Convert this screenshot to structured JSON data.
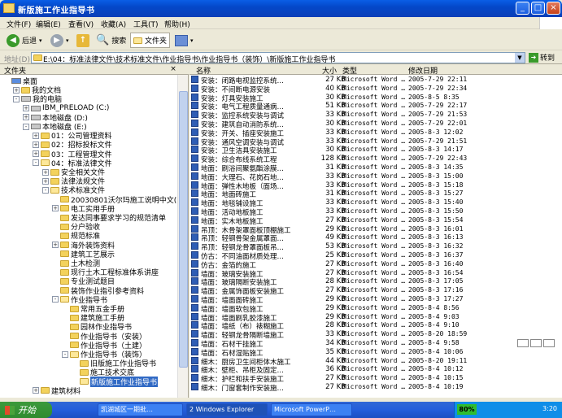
{
  "window": {
    "title": "新版施工作业指导书"
  },
  "menu": [
    "文件(F)",
    "编辑(E)",
    "查看(V)",
    "收藏(A)",
    "工具(T)",
    "帮助(H)"
  ],
  "toolbar": {
    "back": "后退",
    "search": "搜索",
    "folders": "文件夹"
  },
  "address": {
    "label": "地址(D)",
    "path": "E:\\04：标准法律文件\\技术标准文件\\作业指导书\\作业指导书（装饰）\\新版施工作业指导书",
    "go": "转到"
  },
  "left_pane": {
    "title": "文件夹"
  },
  "tree": [
    {
      "label": "桌面",
      "indent": 0,
      "exp": "",
      "icon": "desktop"
    },
    {
      "label": "我的文档",
      "indent": 1,
      "exp": "+",
      "icon": "folder"
    },
    {
      "label": "我的电脑",
      "indent": 1,
      "exp": "-",
      "icon": "computer"
    },
    {
      "label": "IBM_PRELOAD (C:)",
      "indent": 2,
      "exp": "+",
      "icon": "drive"
    },
    {
      "label": "本地磁盘 (D:)",
      "indent": 2,
      "exp": "+",
      "icon": "drive"
    },
    {
      "label": "本地磁盘 (E:)",
      "indent": 2,
      "exp": "-",
      "icon": "drive"
    },
    {
      "label": "01：公司管理资料",
      "indent": 3,
      "exp": "+",
      "icon": "folder"
    },
    {
      "label": "02：招标投标文件",
      "indent": 3,
      "exp": "+",
      "icon": "folder"
    },
    {
      "label": "03：工程管理文件",
      "indent": 3,
      "exp": "+",
      "icon": "folder"
    },
    {
      "label": "04：标准法律文件",
      "indent": 3,
      "exp": "-",
      "icon": "folder-open"
    },
    {
      "label": "安全相关文件",
      "indent": 4,
      "exp": "+",
      "icon": "folder"
    },
    {
      "label": "法律法规文件",
      "indent": 4,
      "exp": "+",
      "icon": "folder"
    },
    {
      "label": "技术标准文件",
      "indent": 4,
      "exp": "-",
      "icon": "folder-open"
    },
    {
      "label": "20030801沃尔玛施工说明中文(2009)",
      "indent": 5,
      "exp": "",
      "icon": "folder"
    },
    {
      "label": "电工实用手册",
      "indent": 5,
      "exp": "+",
      "icon": "folder"
    },
    {
      "label": "发达同事要求学习的规范清单",
      "indent": 5,
      "exp": "",
      "icon": "folder"
    },
    {
      "label": "分户验收",
      "indent": 5,
      "exp": "",
      "icon": "folder"
    },
    {
      "label": "规范标准",
      "indent": 5,
      "exp": "",
      "icon": "folder"
    },
    {
      "label": "海外装饰资料",
      "indent": 5,
      "exp": "+",
      "icon": "folder"
    },
    {
      "label": "建筑工艺展示",
      "indent": 5,
      "exp": "",
      "icon": "folder"
    },
    {
      "label": "土木检测",
      "indent": 5,
      "exp": "",
      "icon": "folder"
    },
    {
      "label": "现行土木工程标准体系讲座",
      "indent": 5,
      "exp": "",
      "icon": "folder"
    },
    {
      "label": "专业测试题目",
      "indent": 5,
      "exp": "",
      "icon": "folder"
    },
    {
      "label": "装饰作业指引参考资料",
      "indent": 5,
      "exp": "",
      "icon": "folder"
    },
    {
      "label": "作业指导书",
      "indent": 5,
      "exp": "-",
      "icon": "folder-open"
    },
    {
      "label": "常用五金手册",
      "indent": 6,
      "exp": "",
      "icon": "folder"
    },
    {
      "label": "建筑施工手册",
      "indent": 6,
      "exp": "",
      "icon": "folder"
    },
    {
      "label": "园林作业指导书",
      "indent": 6,
      "exp": "",
      "icon": "folder"
    },
    {
      "label": "作业指导书（安装）",
      "indent": 6,
      "exp": "",
      "icon": "folder"
    },
    {
      "label": "作业指导书（土建）",
      "indent": 6,
      "exp": "",
      "icon": "folder"
    },
    {
      "label": "作业指导书（装饰）",
      "indent": 6,
      "exp": "-",
      "icon": "folder-open"
    },
    {
      "label": "旧版施工作业指导书",
      "indent": 7,
      "exp": "",
      "icon": "folder"
    },
    {
      "label": "施工技术交底",
      "indent": 7,
      "exp": "",
      "icon": "folder"
    },
    {
      "label": "新版施工作业指导书",
      "indent": 7,
      "exp": "",
      "icon": "folder-open",
      "selected": true
    },
    {
      "label": "建筑材料",
      "indent": 3,
      "exp": "+",
      "icon": "folder"
    }
  ],
  "columns": {
    "name": "名称",
    "size": "大小",
    "type": "类型",
    "date": "修改日期"
  },
  "files": [
    {
      "name": "安装：闭路电视监控系统…",
      "size": "27 KB",
      "type": "Microsoft Word …",
      "date": "2005-7-29 22:11"
    },
    {
      "name": "安装：不间断电源安装",
      "size": "40 KB",
      "type": "Microsoft Word …",
      "date": "2005-7-29 22:34"
    },
    {
      "name": "安装：灯具安装施工",
      "size": "30 KB",
      "type": "Microsoft Word …",
      "date": "2005-8-5 8:35"
    },
    {
      "name": "安装：电气工程质量通病…",
      "size": "51 KB",
      "type": "Microsoft Word …",
      "date": "2005-7-29 22:17"
    },
    {
      "name": "安装：监控系统安装与调试",
      "size": "33 KB",
      "type": "Microsoft Word …",
      "date": "2005-7-29 21:53"
    },
    {
      "name": "安装：建筑自动消防系统…",
      "size": "30 KB",
      "type": "Microsoft Word …",
      "date": "2005-7-29 22:01"
    },
    {
      "name": "安装：开关、插座安装施工",
      "size": "33 KB",
      "type": "Microsoft Word …",
      "date": "2005-8-3 12:02"
    },
    {
      "name": "安装：通风空调安装与调试",
      "size": "33 KB",
      "type": "Microsoft Word …",
      "date": "2005-7-29 21:51"
    },
    {
      "name": "安装：卫生洁具安装施工",
      "size": "30 KB",
      "type": "Microsoft Word …",
      "date": "2005-8-3 14:17"
    },
    {
      "name": "安装：综合布线系统工程",
      "size": "128 KB",
      "type": "Microsoft Word …",
      "date": "2005-7-29 22:43"
    },
    {
      "name": "地面：刷浴间聚氨酯涂膜…",
      "size": "31 KB",
      "type": "Microsoft Word …",
      "date": "2005-8-3 14:35"
    },
    {
      "name": "地面：大理石、花岗石地…",
      "size": "33 KB",
      "type": "Microsoft Word …",
      "date": "2005-8-3 15:00"
    },
    {
      "name": "地面：弹性木地板（面场…",
      "size": "33 KB",
      "type": "Microsoft Word …",
      "date": "2005-8-3 15:18"
    },
    {
      "name": "地面：地面砖施工",
      "size": "31 KB",
      "type": "Microsoft Word …",
      "date": "2005-8-3 15:27"
    },
    {
      "name": "地面：地毯铺设施工",
      "size": "33 KB",
      "type": "Microsoft Word …",
      "date": "2005-8-3 15:40"
    },
    {
      "name": "地面：活动地板施工",
      "size": "33 KB",
      "type": "Microsoft Word …",
      "date": "2005-8-3 15:50"
    },
    {
      "name": "地面：实木地板施工",
      "size": "27 KB",
      "type": "Microsoft Word …",
      "date": "2005-8-3 15:54"
    },
    {
      "name": "吊顶：木骨架罩面板顶棚施工",
      "size": "29 KB",
      "type": "Microsoft Word …",
      "date": "2005-8-3 16:01"
    },
    {
      "name": "吊顶：轻钢骨架金属罩面…",
      "size": "49 KB",
      "type": "Microsoft Word …",
      "date": "2005-8-3 16:13"
    },
    {
      "name": "吊顶：轻钢龙骨罩面板吊…",
      "size": "53 KB",
      "type": "Microsoft Word …",
      "date": "2005-8-3 16:32"
    },
    {
      "name": "仿古：不同油面材质处理…",
      "size": "25 KB",
      "type": "Microsoft Word …",
      "date": "2005-8-3 16:37"
    },
    {
      "name": "仿古：金箔的施工",
      "size": "27 KB",
      "type": "Microsoft Word …",
      "date": "2005-8-3 16:40"
    },
    {
      "name": "墙面：玻璃安装施工",
      "size": "27 KB",
      "type": "Microsoft Word …",
      "date": "2005-8-3 16:54"
    },
    {
      "name": "墙面：玻璃隔断安装施工",
      "size": "28 KB",
      "type": "Microsoft Word …",
      "date": "2005-8-3 17:05"
    },
    {
      "name": "墙面：金属饰面板安装施工",
      "size": "27 KB",
      "type": "Microsoft Word …",
      "date": "2005-8-3 17:16"
    },
    {
      "name": "墙面：墙面面砖施工",
      "size": "29 KB",
      "type": "Microsoft Word …",
      "date": "2005-8-3 17:27"
    },
    {
      "name": "墙面：墙面软包施工",
      "size": "29 KB",
      "type": "Microsoft Word …",
      "date": "2005-8-4 8:56"
    },
    {
      "name": "墙面：墙面刷乳胶漆施工",
      "size": "29 KB",
      "type": "Microsoft Word …",
      "date": "2005-8-4 9:03"
    },
    {
      "name": "墙面：墙纸（布）裱糊施工",
      "size": "28 KB",
      "type": "Microsoft Word …",
      "date": "2005-8-4 9:10"
    },
    {
      "name": "墙面：轻钢龙骨隔断墙施工",
      "size": "33 KB",
      "type": "Microsoft Word …",
      "date": "2005-8-20 18:59"
    },
    {
      "name": "墙面：石材干挂施工",
      "size": "34 KB",
      "type": "Microsoft Word …",
      "date": "2005-8-4 9:58"
    },
    {
      "name": "墙面：石材湿贴施工",
      "size": "35 KB",
      "type": "Microsoft Word …",
      "date": "2005-8-4 10:06"
    },
    {
      "name": "细木：厨房卫生间柜体木施工",
      "size": "44 KB",
      "type": "Microsoft Word …",
      "date": "2005-8-20 19:11"
    },
    {
      "name": "细木：壁柜、吊柜及固定…",
      "size": "36 KB",
      "type": "Microsoft Word …",
      "date": "2005-8-4 10:12"
    },
    {
      "name": "细木：护栏和扶手安装施工",
      "size": "27 KB",
      "type": "Microsoft Word …",
      "date": "2005-8-4 10:15"
    },
    {
      "name": "细木：门窗套制作安装施…",
      "size": "27 KB",
      "type": "Microsoft Word …",
      "date": "2005-8-4 10:19"
    }
  ],
  "taskbar": {
    "start": "开始",
    "tasks": [
      "凯湖城区一期批…",
      "2 Windows Explorer",
      "Microsoft PowerP…"
    ],
    "battery": "80%",
    "clock": "3:20"
  }
}
